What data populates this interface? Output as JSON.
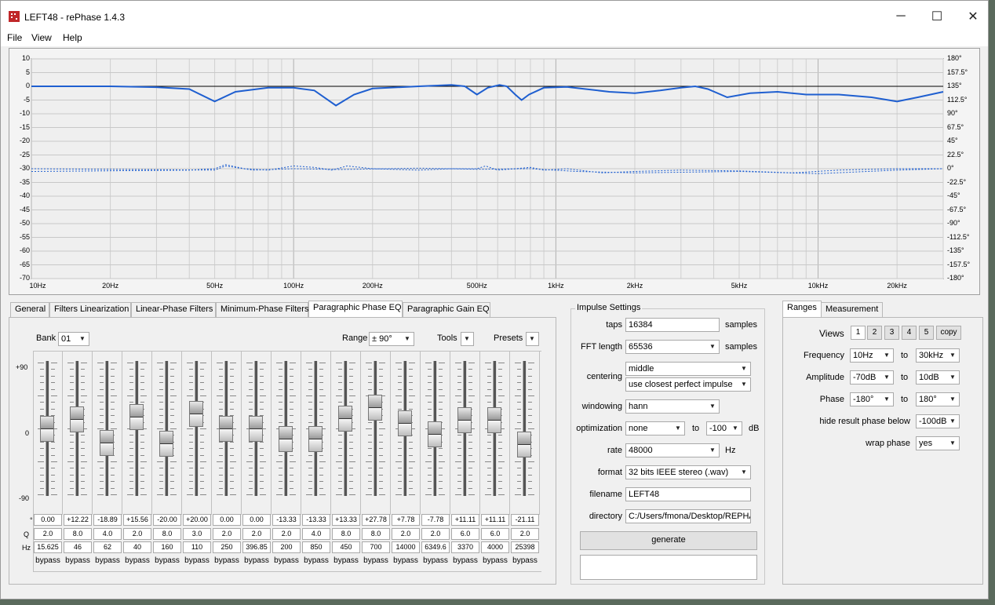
{
  "window": {
    "title": "LEFT48  -  rePhase 1.4.3",
    "controls": [
      "─",
      "☐",
      "✕"
    ]
  },
  "menu": [
    "File",
    "View",
    "Help"
  ],
  "plot": {
    "y_left": [
      "10",
      "5",
      "0",
      "-5",
      "-10",
      "-15",
      "-20",
      "-25",
      "-30",
      "-35",
      "-40",
      "-45",
      "-50",
      "-55",
      "-60",
      "-65",
      "-70"
    ],
    "y_right": [
      "180°",
      "157.5°",
      "135°",
      "112.5°",
      "90°",
      "67.5°",
      "45°",
      "22.5°",
      "0°",
      "-22.5°",
      "-45°",
      "-67.5°",
      "-90°",
      "-112.5°",
      "-135°",
      "-157.5°",
      "-180°"
    ],
    "x_labels": [
      "10Hz",
      "20Hz",
      "50Hz",
      "100Hz",
      "200Hz",
      "500Hz",
      "1kHz",
      "2kHz",
      "5kHz",
      "10kHz",
      "20kHz"
    ]
  },
  "tabs": [
    "General",
    "Filters Linearization",
    "Linear-Phase Filters",
    "Minimum-Phase Filters",
    "Paragraphic Phase EQ",
    "Paragraphic Gain EQ"
  ],
  "eq": {
    "bank_label": "Bank",
    "bank_value": "01",
    "range_label": "Range",
    "range_value": "± 90°",
    "tools_label": "Tools",
    "presets_label": "Presets",
    "scale": [
      "+90",
      "0",
      "-90"
    ],
    "row_labels": [
      "°",
      "Q",
      "Hz"
    ],
    "bypass_label": "bypass",
    "bands": [
      {
        "deg": "0.00",
        "q": "2.0",
        "hz": "15.625"
      },
      {
        "deg": "+12.22",
        "q": "8.0",
        "hz": "46"
      },
      {
        "deg": "-18.89",
        "q": "4.0",
        "hz": "62"
      },
      {
        "deg": "+15.56",
        "q": "2.0",
        "hz": "40"
      },
      {
        "deg": "-20.00",
        "q": "8.0",
        "hz": "160"
      },
      {
        "deg": "+20.00",
        "q": "3.0",
        "hz": "110"
      },
      {
        "deg": "0.00",
        "q": "2.0",
        "hz": "250"
      },
      {
        "deg": "0.00",
        "q": "2.0",
        "hz": "396.85"
      },
      {
        "deg": "-13.33",
        "q": "2.0",
        "hz": "200"
      },
      {
        "deg": "-13.33",
        "q": "4.0",
        "hz": "850"
      },
      {
        "deg": "+13.33",
        "q": "8.0",
        "hz": "450"
      },
      {
        "deg": "+27.78",
        "q": "8.0",
        "hz": "700"
      },
      {
        "deg": "+7.78",
        "q": "2.0",
        "hz": "14000"
      },
      {
        "deg": "-7.78",
        "q": "2.0",
        "hz": "6349.6"
      },
      {
        "deg": "+11.11",
        "q": "6.0",
        "hz": "3370"
      },
      {
        "deg": "+11.11",
        "q": "6.0",
        "hz": "4000"
      },
      {
        "deg": "-21.11",
        "q": "2.0",
        "hz": "25398"
      }
    ]
  },
  "impulse": {
    "legend": "Impulse Settings",
    "taps_label": "taps",
    "taps": "16384",
    "samples": "samples",
    "fft_label": "FFT length",
    "fft": "65536",
    "centering_label": "centering",
    "centering": "middle",
    "centering2": "use closest perfect impulse",
    "windowing_label": "windowing",
    "windowing": "hann",
    "optimization_label": "optimization",
    "optimization": "none",
    "to": "to",
    "opt_db": "-100",
    "db": "dB",
    "rate_label": "rate",
    "rate": "48000",
    "hz": "Hz",
    "format_label": "format",
    "format": "32 bits IEEE stereo (.wav)",
    "filename_label": "filename",
    "filename": "LEFT48",
    "directory_label": "directory",
    "directory": "C:/Users/fmona/Desktop/REPHASE",
    "generate": "generate"
  },
  "ranges": {
    "tabs": [
      "Ranges",
      "Measurement"
    ],
    "views_label": "Views",
    "views": [
      "1",
      "2",
      "3",
      "4",
      "5"
    ],
    "copy": "copy",
    "frequency_label": "Frequency",
    "freq_from": "10Hz",
    "freq_to": "30kHz",
    "amplitude_label": "Amplitude",
    "amp_from": "-70dB",
    "amp_to": "10dB",
    "phase_label": "Phase",
    "phase_from": "-180°",
    "phase_to": "180°",
    "to": "to",
    "hide_label": "hide result phase below",
    "hide_value": "-100dB",
    "wrap_label": "wrap phase",
    "wrap_value": "yes"
  },
  "colors": {
    "curve": "#1f5fd0",
    "background": "#f0f0f0",
    "plot_bg": "#f4f4f4"
  }
}
